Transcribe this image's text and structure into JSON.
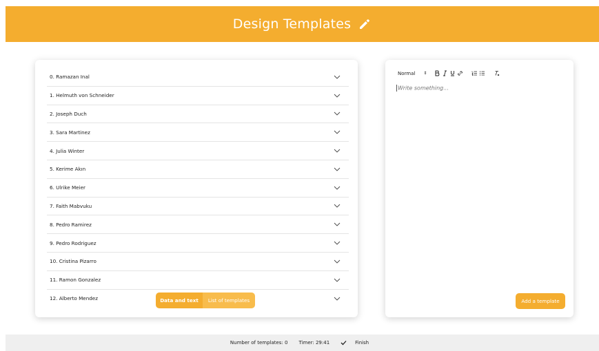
{
  "header": {
    "title": "Design Templates",
    "icon": "pencil-icon"
  },
  "templates": [
    "0. Ramazan Inal",
    "1. Helmuth von Schneider",
    "2. Joseph Duch",
    "3. Sara Martinez",
    "4. Julia Winter",
    "5. Kerime Akın",
    "6. Ulrike Meier",
    "7. Faith Mabvuku",
    "8. Pedro Ramirez",
    "9. Pedro Rodriguez",
    "10. Cristina Pizarro",
    "11. Ramon Gonzalez",
    "12. Alberto Mendez"
  ],
  "tabs": {
    "data_and_text": "Data and text",
    "list_of_templates": "List of templates"
  },
  "editor": {
    "format_select": "Normal",
    "placeholder": "Write something...",
    "toolbar_icons": [
      "bold-icon",
      "italic-icon",
      "underline-icon",
      "link-icon",
      "ordered-list-icon",
      "bullet-list-icon",
      "clear-format-icon"
    ]
  },
  "add_button": "Add a template",
  "footer": {
    "count_text": "Number of templates: 0",
    "timer_text": "Timer: 29:41",
    "finish_label": "Finish"
  },
  "colors": {
    "accent": "#f4ad2f",
    "accent_light": "#f8bc4c",
    "footer_bg": "#efefef"
  }
}
